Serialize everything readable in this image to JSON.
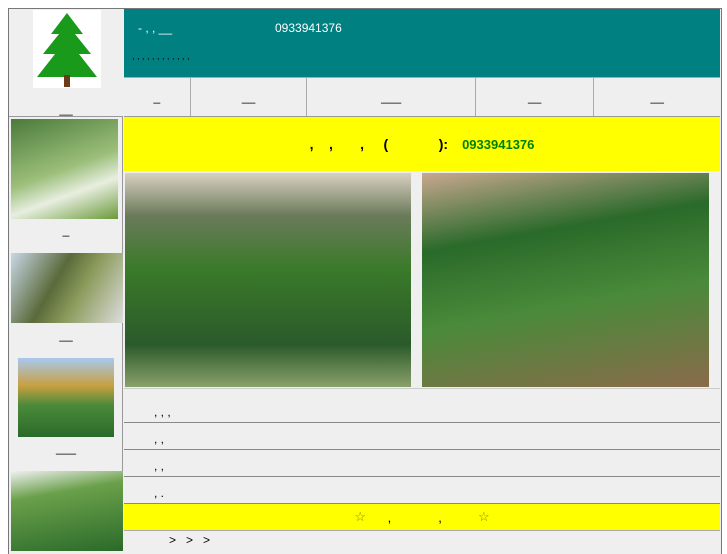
{
  "header": {
    "title": "-     , ,   __",
    "phone": "0933941376",
    "subtitle": ", ,   ,  ,  ,    ,   ,  ,  ,  , ,  ,"
  },
  "nav": [
    "_",
    "__",
    "___",
    "__",
    "__"
  ],
  "banner": {
    "text": ",    ,       ,     (             ):",
    "phone": "0933941376"
  },
  "sidebar": {
    "captions": [
      "_",
      "__",
      "___",
      ""
    ]
  },
  "rows": [
    ",          ,          ,",
    ",           ,",
    ",           ,",
    ",                  ."
  ],
  "footer_banner": {
    "star_left": "☆",
    "text": "      ,             ,          ",
    "star_right": "☆"
  },
  "breadcrumb": ">   >   >",
  "colors": {
    "teal": "#008080",
    "yellow": "#ffff00",
    "phone_green": "#008000"
  }
}
